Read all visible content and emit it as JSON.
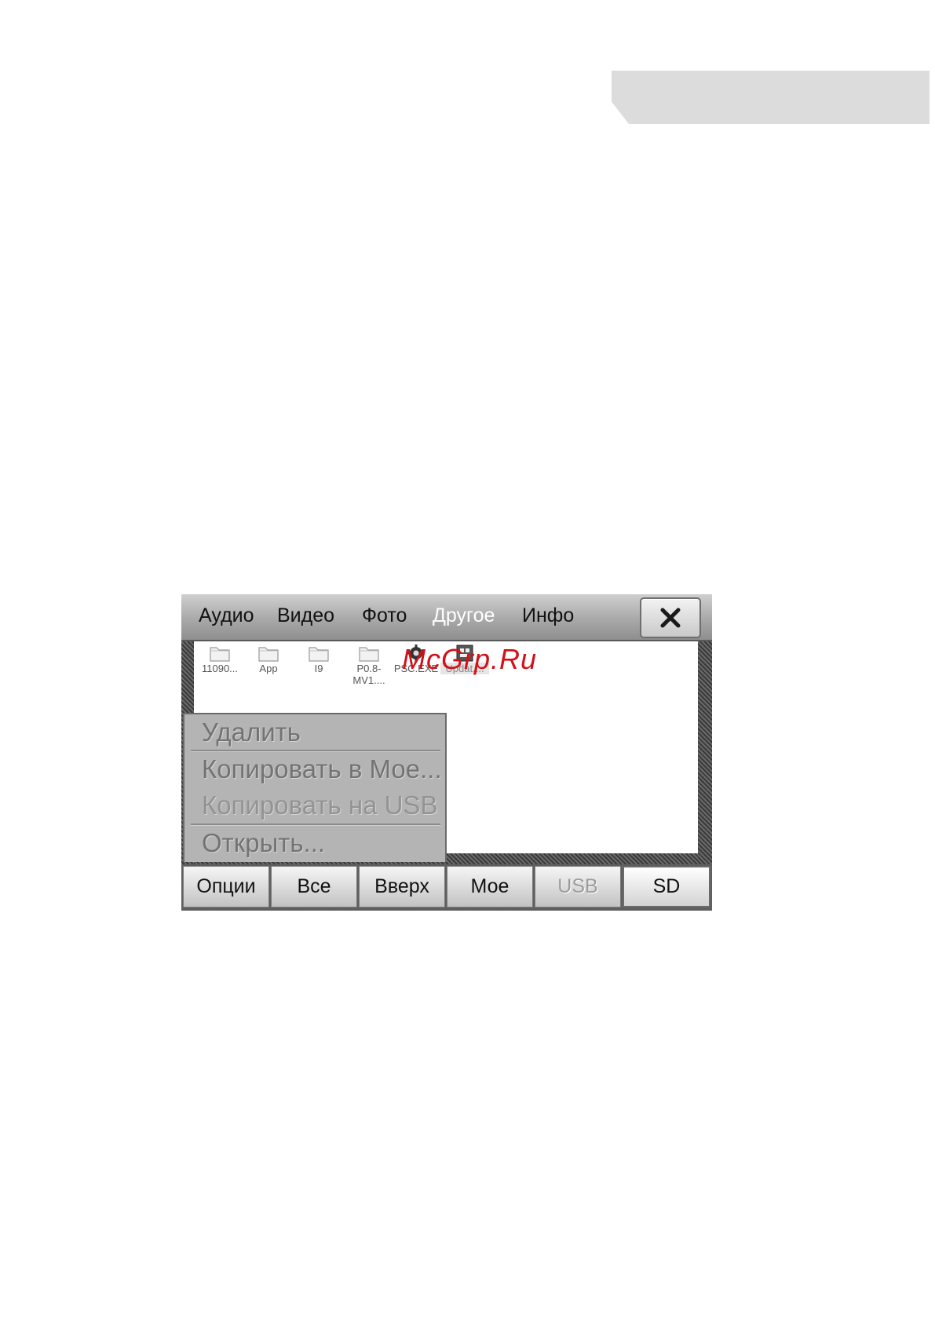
{
  "window": {
    "close_label": "close"
  },
  "tabs": [
    {
      "label": "Аудио"
    },
    {
      "label": "Видео"
    },
    {
      "label": "Фото"
    },
    {
      "label": "Другое",
      "active": true
    },
    {
      "label": "Инфо"
    }
  ],
  "files": [
    {
      "name": "11090...",
      "icon": "folder-icon"
    },
    {
      "name": "App",
      "icon": "folder-icon"
    },
    {
      "name": "I9",
      "icon": "folder-icon"
    },
    {
      "name": "P0.8-",
      "name2": "MV1....",
      "icon": "folder-icon"
    },
    {
      "name": "PSC.EXE",
      "icon": "gear-file-icon"
    },
    {
      "name": "Updat....",
      "icon": "executable-file-icon",
      "selected": true
    }
  ],
  "watermark": "McGrp.Ru",
  "context_menu": {
    "items": [
      {
        "label": "Удалить"
      },
      {
        "label": "Копировать в Мое..."
      },
      {
        "label": "Копировать на USB",
        "disabled": true
      },
      {
        "label": "Открыть..."
      }
    ]
  },
  "buttons": [
    {
      "label": "Опции"
    },
    {
      "label": "Все"
    },
    {
      "label": "Вверх"
    },
    {
      "label": "Мое"
    },
    {
      "label": "USB",
      "disabled": true
    },
    {
      "label": "SD",
      "active": true
    }
  ],
  "colors": {
    "accent_watermark": "#d31018",
    "panel_gray": "#b4b4b4"
  }
}
